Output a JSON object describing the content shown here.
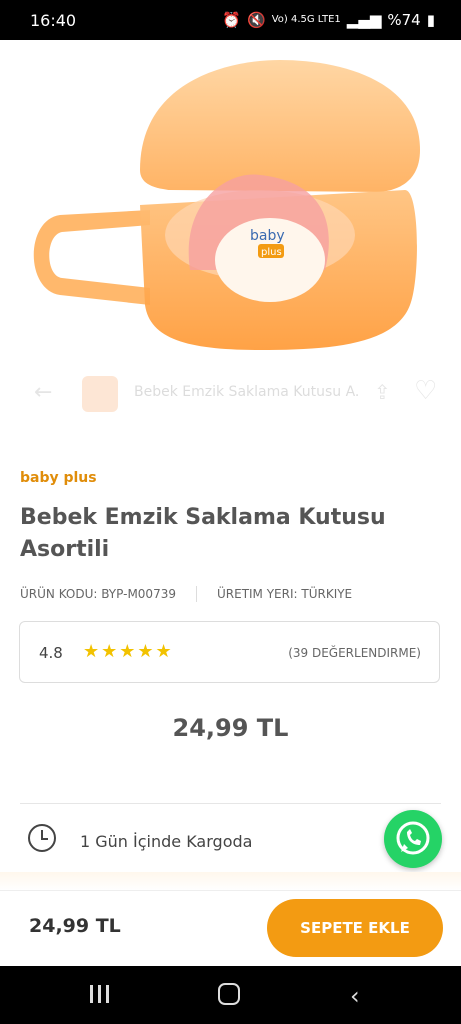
{
  "status_bar": {
    "time": "16:40",
    "network": "Vo) 4.5G LTE1",
    "battery": "%74"
  },
  "product_image": {
    "description_icon": "pacifier-case-image"
  },
  "sticky_header": {
    "back_icon": "arrow-left-icon",
    "title": "Bebek Emzik Saklama Kutusu A.",
    "share_icon": "share-icon",
    "favorite_icon": "heart-icon"
  },
  "product": {
    "brand": "baby plus",
    "title": "Bebek Emzik Saklama Kutusu Asortili",
    "code": "ÜRÜN KODU: BYP-M00739",
    "origin": "ÜRETIM YERI: TÜRKIYE",
    "rating": "4.8",
    "stars": "★★★★★",
    "review_count": "(39 DEĞERLENDIRME)",
    "price": "24,99 TL",
    "shipping": "1 Gün İçinde Kargoda"
  },
  "bottom_bar": {
    "price": "24,99 TL",
    "cart_button": "SEPETE EKLE"
  },
  "colors": {
    "accent": "#f39b12",
    "brand": "#e08d0a",
    "whatsapp": "#25d366",
    "stars": "#f2c200"
  }
}
